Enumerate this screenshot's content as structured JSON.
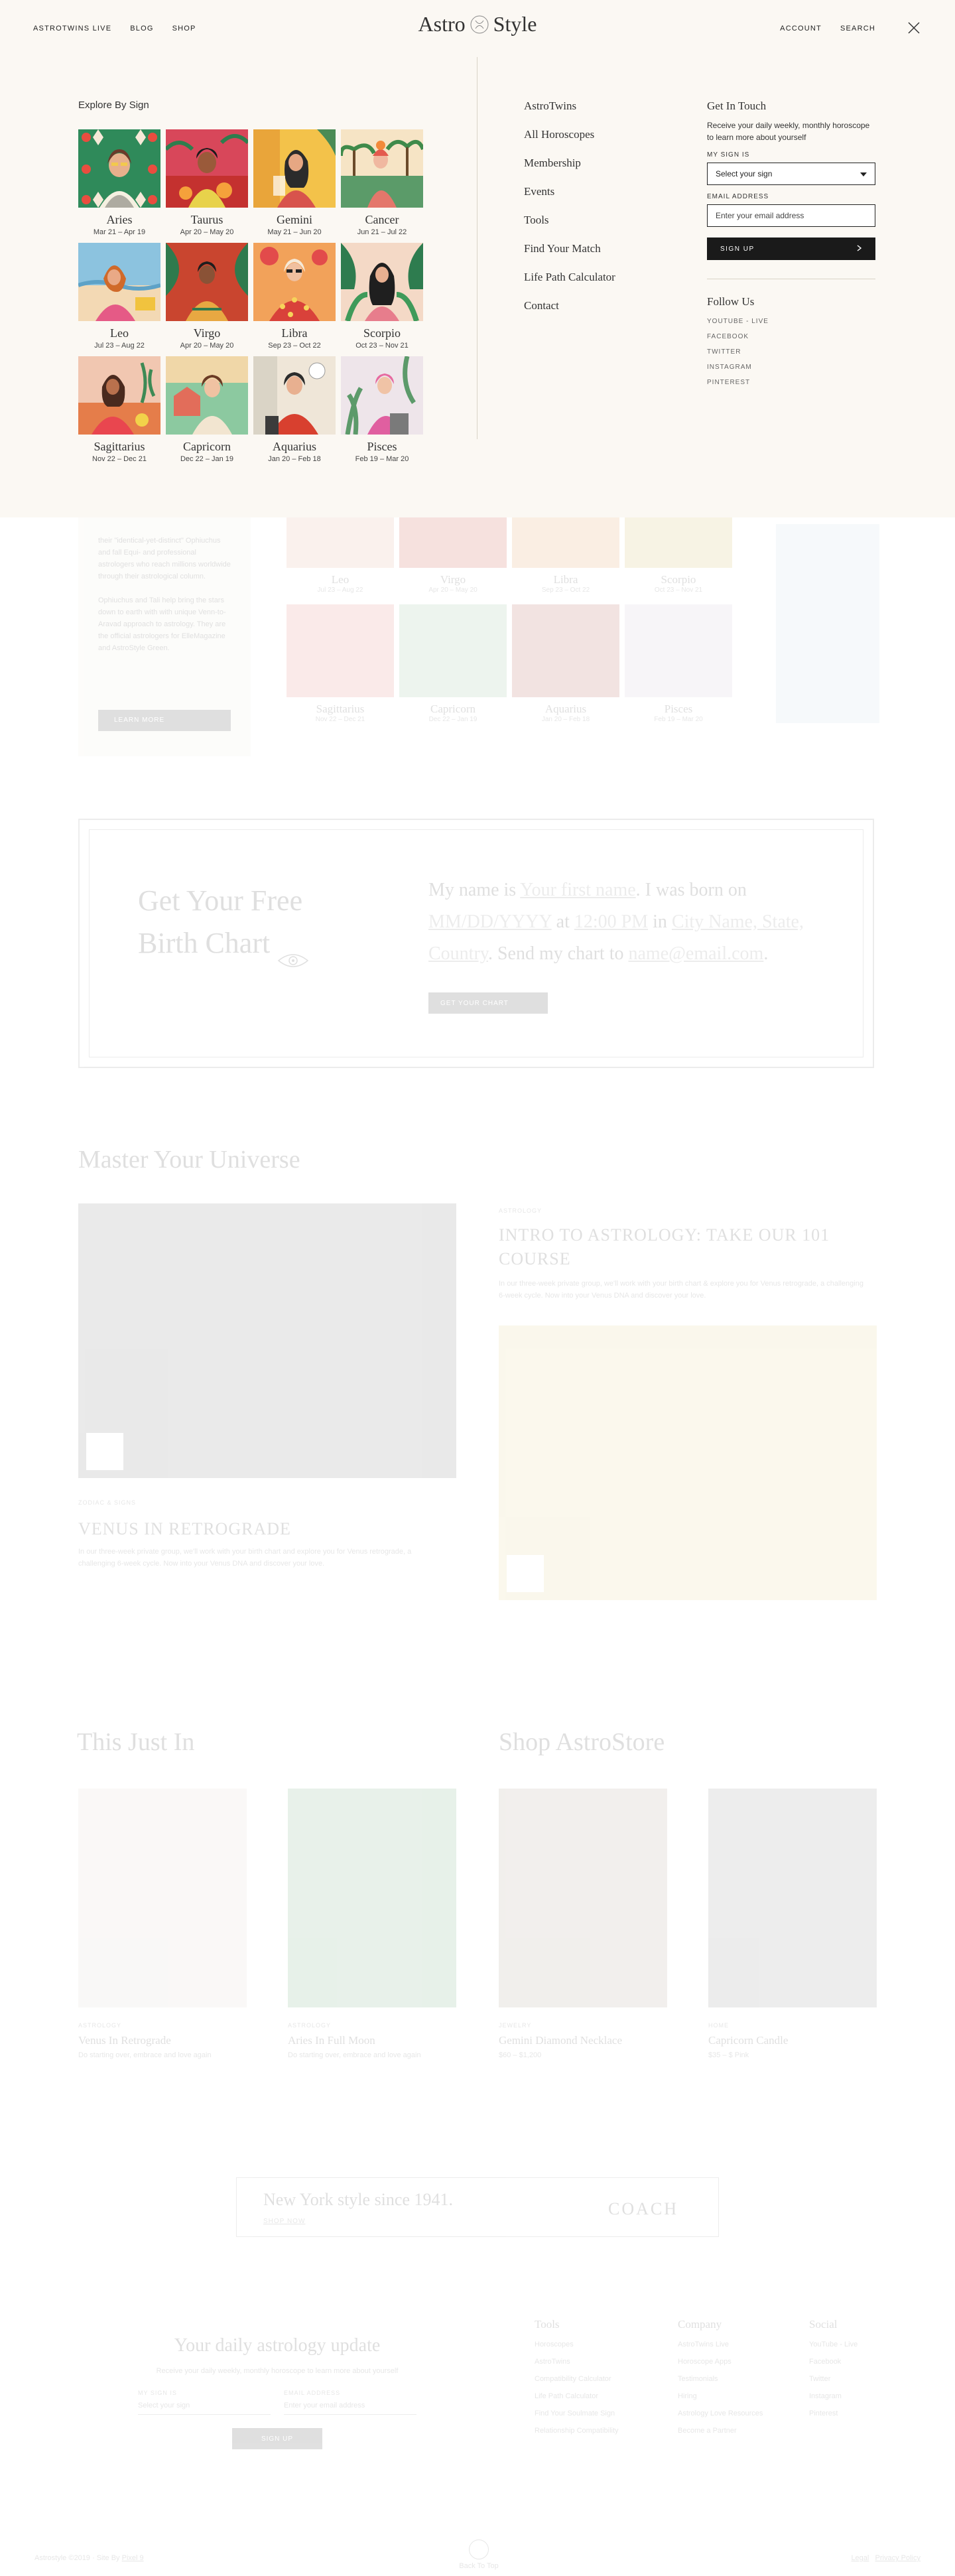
{
  "nav": {
    "left": [
      "ASTROTWINS LIVE",
      "BLOG",
      "SHOP"
    ],
    "right": [
      "ACCOUNT",
      "SEARCH"
    ],
    "logo_left": "Astro",
    "logo_right": "Style"
  },
  "explore": {
    "title": "Explore By Sign",
    "signs": [
      {
        "name": "Aries",
        "dates": "Mar 21 – Apr 19"
      },
      {
        "name": "Taurus",
        "dates": "Apr 20 – May 20"
      },
      {
        "name": "Gemini",
        "dates": "May 21 – Jun 20"
      },
      {
        "name": "Cancer",
        "dates": "Jun 21 – Jul 22"
      },
      {
        "name": "Leo",
        "dates": "Jul 23 – Aug 22"
      },
      {
        "name": "Virgo",
        "dates": "Apr 20 – May 20"
      },
      {
        "name": "Libra",
        "dates": "Sep 23 – Oct 22"
      },
      {
        "name": "Scorpio",
        "dates": "Oct 23 – Nov 21"
      },
      {
        "name": "Sagittarius",
        "dates": "Nov 22 – Dec 21"
      },
      {
        "name": "Capricorn",
        "dates": "Dec 22 – Jan 19"
      },
      {
        "name": "Aquarius",
        "dates": "Jan 20 – Feb 18"
      },
      {
        "name": "Pisces",
        "dates": "Feb 19 – Mar 20"
      }
    ]
  },
  "menu_links": [
    "AstroTwins",
    "All Horoscopes",
    "Membership",
    "Events",
    "Tools",
    "Find Your Match",
    "Life Path Calculator",
    "Contact"
  ],
  "get_in_touch": {
    "title": "Get In Touch",
    "text": "Receive your daily weekly, monthly horoscope to learn more about yourself",
    "sign_label": "MY SIGN IS",
    "sign_value": "Select your sign",
    "email_label": "EMAIL ADDRESS",
    "email_placeholder": "Enter your email address",
    "button": "SIGN UP",
    "follow_title": "Follow Us",
    "social": [
      "YOUTUBE - LIVE",
      "FACEBOOK",
      "TWITTER",
      "INSTAGRAM",
      "PINTEREST"
    ]
  },
  "background": {
    "side_text_1": "their \"identical-yet-distinct\" Ophiuchus and fall Equi- and professional astrologers who reach millions worldwide through their astrological column.",
    "side_text_2": "Ophiuchus and Tali help bring the stars down to earth with with unique Venn-to-Aravad approach to astrology. They are the official astrologers for ElleMagazine and AstroStyle Green.",
    "learn_more": "LEARN MORE",
    "grid": [
      {
        "name": "Leo",
        "dates": "Jul 23 – Aug 22"
      },
      {
        "name": "Virgo",
        "dates": "Apr 20 – May 20"
      },
      {
        "name": "Libra",
        "dates": "Sep 23 – Oct 22"
      },
      {
        "name": "Scorpio",
        "dates": "Oct 23 – Nov 21"
      },
      {
        "name": "Sagittarius",
        "dates": "Nov 22 – Dec 21"
      },
      {
        "name": "Capricorn",
        "dates": "Dec 22 – Jan 19"
      },
      {
        "name": "Aquarius",
        "dates": "Jan 20 – Feb 18"
      },
      {
        "name": "Pisces",
        "dates": "Feb 19 – Mar 20"
      }
    ],
    "birth_chart": {
      "title_1": "Get Your Free",
      "title_2": "Birth Chart",
      "f1": "My name is ",
      "name": "Your first name",
      "f2": ". I was born on ",
      "date": "MM/DD/YYYY",
      "f3": " at ",
      "time": "12:00 PM",
      "f4": " in ",
      "place": "City Name, State, Country",
      "f5": ". Send my chart to ",
      "email": "name@email.com",
      "f6": ".",
      "button": "GET YOUR CHART"
    },
    "master_title": "Master Your Universe",
    "card1": {
      "tag": "ZODIAC & SIGNS",
      "title": "VENUS IN RETROGRADE",
      "desc": "In our three-week private group, we'll work with your birth chart and explore you for Venus retrograde, a challenging 6-week cycle. Now into your Venus DNA and discover your love."
    },
    "card2": {
      "tag": "ASTROLOGY",
      "title": "INTRO TO ASTROLOGY: TAKE OUR 101 COURSE",
      "desc": "In our three-week private group, we'll work with your birth chart & explore you for Venus retrograde, a challenging 6-week cycle. Now into your Venus DNA and discover your love."
    },
    "just_in_title": "This Just In",
    "shop_title": "Shop AstroStore",
    "products": [
      {
        "cat": "ASTROLOGY",
        "name": "Venus In Retrograde",
        "sub": "Do starting over, embrace and love again"
      },
      {
        "cat": "ASTROLOGY",
        "name": "Aries In Full Moon",
        "sub": "Do starting over, embrace and love again"
      },
      {
        "cat": "JEWELRY",
        "name": "Gemini Diamond Necklace",
        "sub": "$60 – $1,200"
      },
      {
        "cat": "HOME",
        "name": "Capricorn Candle",
        "sub": "$35 – $ Pink"
      }
    ],
    "ad": {
      "title": "New York style since 1941.",
      "link": "SHOP NOW",
      "brand": "COACH"
    },
    "daily": {
      "title": "Your daily astrology update",
      "text": "Receive your daily weekly, monthly horoscope to learn more about yourself",
      "sign_label": "MY SIGN IS",
      "sign_value": "Select your sign",
      "email_label": "EMAIL ADDRESS",
      "email_value": "Enter your email address",
      "button": "SIGN UP"
    },
    "footer_cols": [
      {
        "title": "Tools",
        "items": [
          "Horoscopes",
          "AstroTwins",
          "Compatibility Calculator",
          "Life Path Calculator",
          "Find Your Soulmate Sign",
          "Relationship Compatibility"
        ]
      },
      {
        "title": "Company",
        "items": [
          "AstroTwins Live",
          "Horoscope Apps",
          "Testimonials",
          "Hiring",
          "Astrology Love Resources",
          "Become a Partner"
        ]
      },
      {
        "title": "Social",
        "items": [
          "YouTube - Live",
          "Facebook",
          "Twitter",
          "Instagram",
          "Pinterest"
        ]
      }
    ],
    "copyright": "Astrostyle ©2019 · Site By ",
    "credit": "Pixel 9",
    "back_to_top": "Back To Top",
    "legal": [
      "Legal",
      "Privacy Policy"
    ]
  }
}
